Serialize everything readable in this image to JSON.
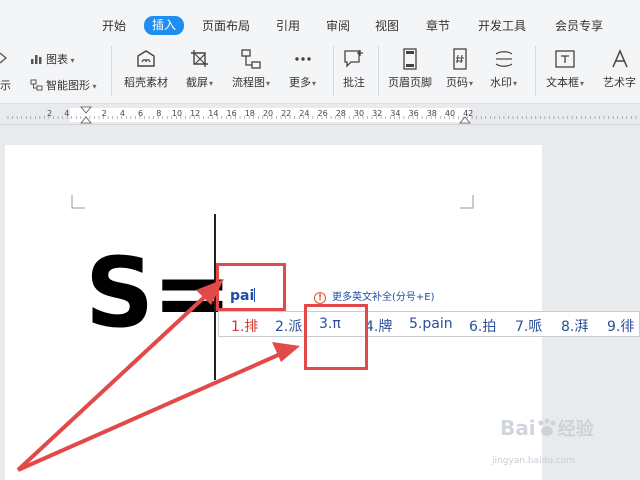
{
  "menu": {
    "tabs": [
      "开始",
      "插入",
      "页面布局",
      "引用",
      "审阅",
      "视图",
      "章节",
      "开发工具",
      "会员专享"
    ],
    "active_tab": "插入"
  },
  "ribbon": {
    "left_partial_label": "示",
    "chart_label": "图表",
    "smart_shape_label": "智能图形",
    "buttons": [
      {
        "label": "稻壳素材",
        "icon": "material-icon"
      },
      {
        "label": "截屏",
        "icon": "screenshot-icon"
      },
      {
        "label": "流程图",
        "icon": "flowchart-icon"
      },
      {
        "label": "更多",
        "icon": "more-icon"
      },
      {
        "label": "批注",
        "icon": "comment-icon"
      },
      {
        "label": "页眉页脚",
        "icon": "header-footer-icon"
      },
      {
        "label": "页码",
        "icon": "page-number-icon"
      },
      {
        "label": "水印",
        "icon": "watermark-icon"
      },
      {
        "label": "文本框",
        "icon": "textbox-icon"
      },
      {
        "label": "艺术字",
        "icon": "wordart-icon"
      }
    ]
  },
  "ruler": {
    "numbers": [
      "2",
      "4",
      "2",
      "4",
      "6",
      "8",
      "10",
      "12",
      "14",
      "16",
      "18",
      "20",
      "22",
      "24",
      "26",
      "28",
      "30",
      "32",
      "34",
      "36",
      "38",
      "40",
      "42"
    ]
  },
  "document": {
    "formula_text": "S="
  },
  "ime": {
    "input_text": "pai",
    "hint_text": "更多英文补全(分号+E)",
    "candidates": [
      "1.排",
      "2.派",
      "3.π",
      "4.牌",
      "5.pain",
      "6.拍",
      "7.哌",
      "8.湃",
      "9.徘"
    ]
  },
  "watermark": {
    "brand": "Bai",
    "brand_cn": "经验",
    "url": "jingyan.baidu.com"
  },
  "colors": {
    "accent": "#1f8ef1",
    "highlight": "#e24a4a",
    "ime_text": "#2b4f9b",
    "ime_first": "#d9342b"
  }
}
